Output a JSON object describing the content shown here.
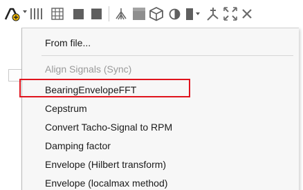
{
  "toolbar": {
    "icons": [
      "signal-add-icon",
      "dropdown-arrow-icon",
      "multi-channel-bars-icon",
      "grid-table-icon",
      "square-icon",
      "filled-square-icon",
      "waveform-tree-icon",
      "gray-block-icon",
      "cube-icon",
      "half-circle-icon",
      "bar-chart-icon",
      "dropdown-arrow-icon",
      "joint-icon",
      "expand-icon",
      "close-x-icon"
    ]
  },
  "menu": {
    "items": [
      {
        "label": "From file...",
        "enabled": true
      },
      {
        "label": "Align Signals (Sync)",
        "enabled": false
      },
      {
        "label": "BearingEnvelopeFFT",
        "enabled": true,
        "highlighted": true
      },
      {
        "label": "Cepstrum",
        "enabled": true
      },
      {
        "label": "Convert Tacho-Signal to RPM",
        "enabled": true
      },
      {
        "label": "Damping factor",
        "enabled": true
      },
      {
        "label": "Envelope (Hilbert transform)",
        "enabled": true
      },
      {
        "label": "Envelope (localmax method)",
        "enabled": true
      }
    ]
  },
  "colors": {
    "highlight_border": "#e0131d",
    "menu_background": "#f7f7f7",
    "disabled_text": "#9a9a9a",
    "icon_gray": "#5f5f5f"
  }
}
